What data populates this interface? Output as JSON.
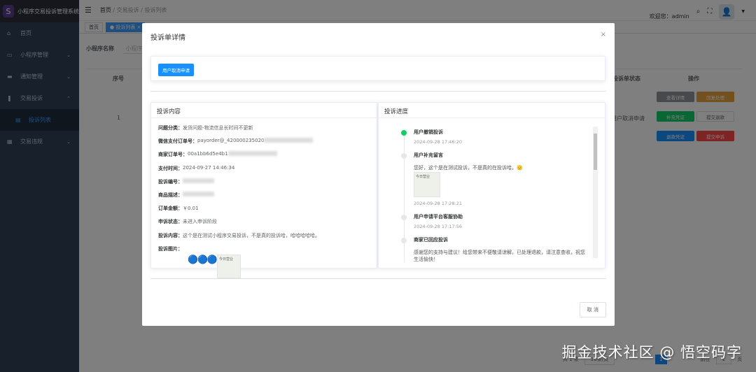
{
  "app": {
    "title": "小程序交易投诉管理系统",
    "logo_letter": "S"
  },
  "sidebar": {
    "items": [
      {
        "label": "首页",
        "icon": "home-icon"
      },
      {
        "label": "小程序管理",
        "icon": "app-icon",
        "arrow": "⌄"
      },
      {
        "label": "通知管理",
        "icon": "message-icon",
        "arrow": "⌄"
      },
      {
        "label": "交易投诉",
        "icon": "complaint-icon",
        "arrow": "⌃"
      },
      {
        "label": "投诉列表",
        "icon": "list-icon",
        "sub": true
      },
      {
        "label": "交易违规",
        "icon": "violation-icon",
        "arrow": "⌄"
      }
    ]
  },
  "header": {
    "breadcrumb": [
      "首页",
      "交易投诉",
      "投诉列表"
    ],
    "welcome": "欢迎您：admin"
  },
  "tags": [
    "首页",
    "● 投诉列表 ×"
  ],
  "page": {
    "search_label": "小程序名称",
    "search_placeholder": "小程序",
    "columns": {
      "index": "序号",
      "status": "投诉单状态",
      "actions": "操作"
    },
    "row": {
      "index": "1",
      "status": "用户取消申请"
    },
    "actions": [
      "查看详情",
      "回复处理",
      "补充凭证",
      "提交退款",
      "退款凭证",
      "提交申诉"
    ],
    "pager": {
      "total": "共 1 条",
      "size": "10条/页",
      "page": "1",
      "goto": "前往",
      "goto_val": "1",
      "unit": "页"
    }
  },
  "modal": {
    "title": "投诉单详情",
    "close": "×",
    "status_button": "用户取消申请",
    "content_title": "投诉内容",
    "fields": [
      {
        "k": "问题分类：",
        "v": "发货问题-物流信息长时间不更新"
      },
      {
        "k": "微信支付订单号：",
        "v": "payorder@_420000235020",
        "blur": true
      },
      {
        "k": "商家订单号：",
        "v": "00a1bb6d5e4b1",
        "blur": true
      },
      {
        "k": "支付时间：",
        "v": "2024-09-27 14:46:34"
      },
      {
        "k": "投诉编号：",
        "v": "",
        "blur": true
      },
      {
        "k": "商品描述：",
        "v": "",
        "blur": true
      },
      {
        "k": "订单金额：",
        "v": "￥0.01"
      },
      {
        "k": "申诉状态：",
        "v": "未进入申诉阶段"
      },
      {
        "k": "投诉内容：",
        "v": "这个是在测试小程序交易投诉，不是真的投诉哈，哈哈哈哈哈。"
      }
    ],
    "images_label": "投诉图片：",
    "image_caption": "今日营业",
    "progress_title": "投诉进度",
    "timeline": [
      {
        "title": "用户撤销投诉",
        "time": "2024-09-28 17:46:20",
        "active": true
      },
      {
        "title": "用户补充留言",
        "content": "您好，这个是在测试投诉，不是真的在投诉哈。🫡",
        "image": "今日营业",
        "time": "2024-09-28 17:28:21"
      },
      {
        "title": "用户申请平台客服协助",
        "time": "2024-09-28 17:17:56"
      },
      {
        "title": "商家已回应投诉",
        "content": "感谢您的支持与建议！给您带来不便敬请谅解，已处理退款，请注意查收，祝您生活愉快！"
      }
    ],
    "cancel": "取 消"
  },
  "watermark": "掘金技术社区 @ 悟空码字"
}
